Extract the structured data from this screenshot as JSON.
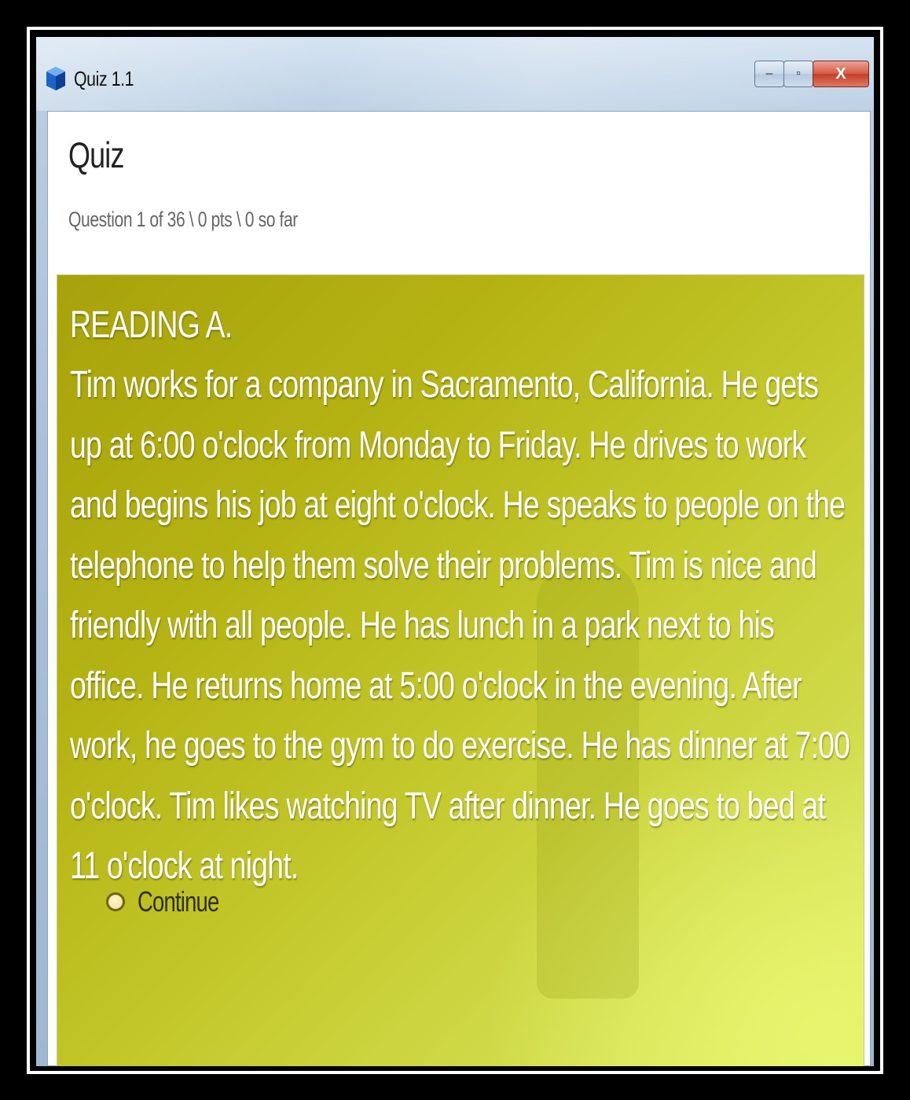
{
  "window": {
    "title": "Quiz 1.1",
    "icon": "blue-cube-icon",
    "controls": {
      "minimize": "–",
      "maximize": "▫",
      "close": "X"
    }
  },
  "quiz": {
    "title": "Quiz",
    "status": "Question 1 of 36 \\ 0 pts \\ 0 so far"
  },
  "question": {
    "heading": "READING A.",
    "passage": "Tim works for a company in Sacramento, California. He gets up at 6:00 o'clock from Monday to Friday. He drives to work and begins his job at eight o'clock. He speaks to people on the telephone to help them solve their problems. Tim is nice and friendly with all people. He has lunch in a park next to his office. He returns home at 5:00 o'clock in the evening. After work, he goes to the gym to do exercise. He has dinner at 7:00 o'clock. Tim likes watching TV after dinner. He goes to bed at 11 o'clock at night.",
    "choices": [
      {
        "label": "Continue",
        "selected": false
      }
    ]
  },
  "colors": {
    "panel": "#b5b414",
    "panel_light": "#e2ef6c",
    "close_button": "#c43d26"
  }
}
